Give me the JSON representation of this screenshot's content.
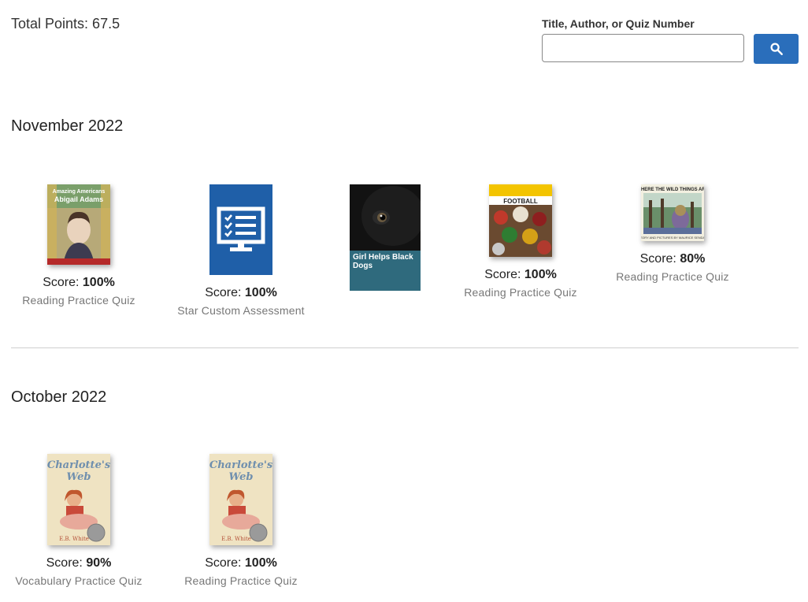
{
  "header": {
    "total_points": "Total Points: 67.5",
    "search_label": "Title, Author, or Quiz Number",
    "search_value": "",
    "search_placeholder": "",
    "search_icon": "search-icon"
  },
  "colors": {
    "accent": "#2a6ebb",
    "divider": "#cfcfcf",
    "muted": "#777777"
  },
  "sections": [
    {
      "month": "November 2022",
      "items": [
        {
          "cover": "abigail-adams-book-cover",
          "cover_title": "Amazing Americans: Abigail Adams",
          "score_label": "Score:",
          "score": "100%",
          "type": "Reading Practice Quiz"
        },
        {
          "cover": "assessment-checklist-icon",
          "score_label": "Score:",
          "score": "100%",
          "type": "Star Custom Assessment"
        },
        {
          "cover": "girl-helps-black-dogs-book-cover",
          "cover_title": "Girl Helps Black Dogs"
        },
        {
          "cover": "football-book-cover",
          "cover_title": "FOOTBALL",
          "score_label": "Score:",
          "score": "100%",
          "type": "Reading Practice Quiz"
        },
        {
          "cover": "where-the-wild-things-are-book-cover",
          "cover_title": "WHERE THE WILD THINGS ARE",
          "score_label": "Score:",
          "score": "80%",
          "type": "Reading Practice Quiz"
        }
      ]
    },
    {
      "month": "October 2022",
      "items": [
        {
          "cover": "charlottes-web-book-cover",
          "cover_title": "Charlotte's Web",
          "score_label": "Score:",
          "score": "90%",
          "type": "Vocabulary Practice Quiz"
        },
        {
          "cover": "charlottes-web-book-cover",
          "cover_title": "Charlotte's Web",
          "score_label": "Score:",
          "score": "100%",
          "type": "Reading Practice Quiz"
        }
      ]
    }
  ]
}
